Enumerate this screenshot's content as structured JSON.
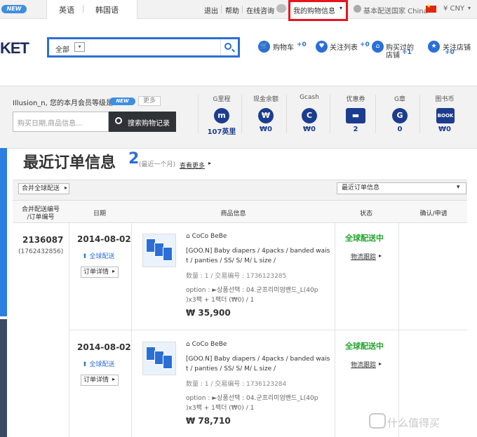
{
  "topbar": {
    "new_badge": "NEW",
    "lang_en": "英语",
    "lang_ko": "韩国语",
    "logout": "退出",
    "help": "帮助",
    "chat": "在线咨询",
    "my_shopping": "我的购物信息",
    "ship_country": "基本配送国家 China",
    "currency": "¥ CNY"
  },
  "header": {
    "logo": "KET",
    "search_category": "全部",
    "cart_label": "购物车",
    "cart_count": "+0",
    "watch_label": "关注列表",
    "watch_count": "+0",
    "visited_label1": "购买过的",
    "visited_label2": "店铺",
    "visited_count": "+1",
    "follow_label": "关注店铺",
    "follow_count": "+0"
  },
  "member": {
    "greeting": "Illusion_n, 您的本月会员等级是",
    "badge": "NEW",
    "more": "更多",
    "date_placeholder": "购买日期,商品信息...",
    "search_btn": "搜索购物记录",
    "items": [
      {
        "label": "G里程",
        "icon": "m",
        "value": "107英里"
      },
      {
        "label": "现金余额",
        "icon": "₩",
        "value": "₩0"
      },
      {
        "label": "Gcash",
        "icon": "C",
        "value": "₩0"
      },
      {
        "label": "优惠券",
        "icon": "▬",
        "value": "2"
      },
      {
        "label": "G章",
        "icon": "G",
        "value": "0"
      },
      {
        "label": "图书币",
        "icon": "BOOK",
        "value": "₩0"
      }
    ]
  },
  "page": {
    "title": "最近订单信息",
    "count": "2",
    "sub": "(最近一个月)",
    "see_more": "查看更多",
    "merge_btn": "合并全球配送",
    "sort": "最近订单信息"
  },
  "table": {
    "headers": [
      "合并配送编号\n/订单编号",
      "日期",
      "商品信息",
      "状态",
      "确认/申请"
    ],
    "h1a": "合并配送编号",
    "h1b": "/订单编号",
    "h2": "日期",
    "h3": "商品信息",
    "h4": "状态",
    "h5": "确认/申请"
  },
  "orders": [
    {
      "order_no": "2136087",
      "order_sub": "(1762432856)",
      "date": "2014-08-02",
      "global": "全球配送",
      "detail": "订单详情",
      "shop": "CoCo BeBe",
      "name1": "[GOO.N] Baby diapers / 4packs / banded wais",
      "name2": "t / panties / SS/ S/ M/ L size /",
      "meta": "数量 : 1 / 交易编号 : 1736123285",
      "option1": "option : ►상품선택 : 04.군프리미엄밴드_L(40p",
      "option2": ")x3팩 + 1팩더 (₩0) / 1",
      "price": "₩ 35,900",
      "status": "全球配送中",
      "track": "物流跟踪"
    },
    {
      "order_no": "",
      "order_sub": "",
      "date": "2014-08-02",
      "global": "全球配送",
      "detail": "订单详情",
      "shop": "CoCo BeBe",
      "name1": "[GOO.N] Baby diapers / 4packs / banded wais",
      "name2": "t / panties / SS/ S/ M/ L size /",
      "meta": "数量 : 1 / 交易编号 : 1736123284",
      "option1": "option : ►상품선택 : 04.군프리미엄밴드_L(40p",
      "option2": ")x3팩 + 1팩더 (₩0) / 1",
      "price": "₩ 78,710",
      "status": "全球配送中",
      "track": "物流跟踪"
    }
  ],
  "watermark": "什么值得买"
}
